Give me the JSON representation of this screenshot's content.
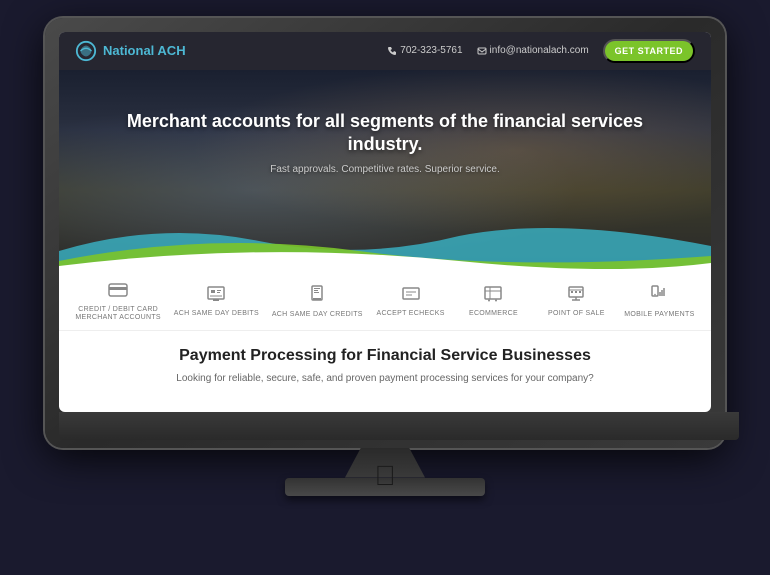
{
  "monitor": {
    "apple_symbol": ""
  },
  "header": {
    "logo_text": "National ACH",
    "phone": "702-323-5761",
    "email": "info@nationalach.com",
    "cta_button": "GET STARTED"
  },
  "hero": {
    "title": "Merchant accounts for all segments of the\nfinancial services industry.",
    "subtitle": "Fast approvals. Competitive rates. Superior service."
  },
  "services": [
    {
      "label": "CREDIT / DEBIT CARD\nMERCHANT ACCOUNTS",
      "icon": "💳"
    },
    {
      "label": "ACH SAME DAY DEBITS",
      "icon": "🖥"
    },
    {
      "label": "ACH SAME DAY CREDITS",
      "icon": "📱"
    },
    {
      "label": "ACCEPT ECHECKS",
      "icon": "🖨"
    },
    {
      "label": "ECOMMERCE",
      "icon": "🛒"
    },
    {
      "label": "POINT OF SALE",
      "icon": "💹"
    },
    {
      "label": "MOBILE PAYMENTS",
      "icon": "📊"
    }
  ],
  "content": {
    "title": "Payment Processing for Financial Service Businesses",
    "subtitle": "Looking for reliable, secure, safe, and proven payment processing services for your company?"
  }
}
